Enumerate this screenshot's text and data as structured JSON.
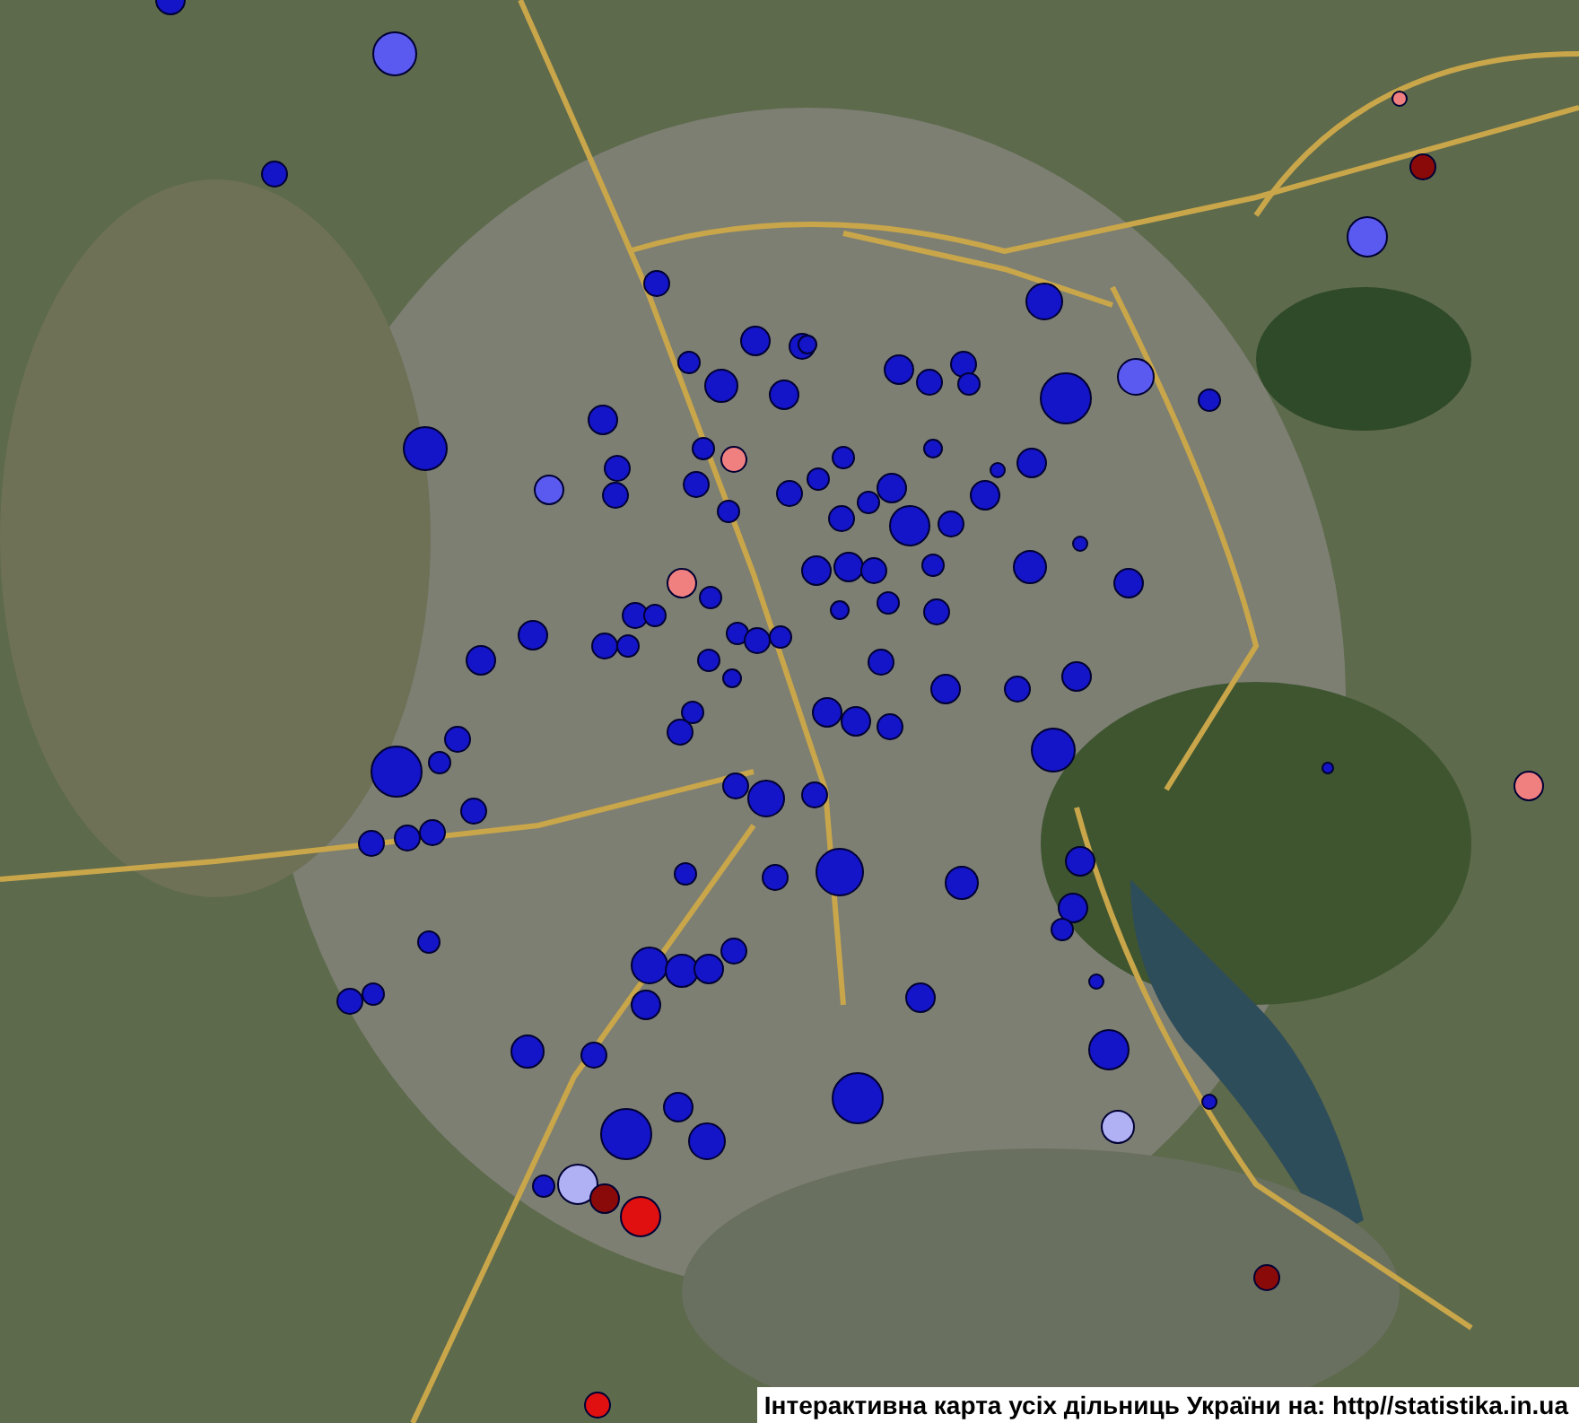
{
  "map": {
    "caption": "Інтерактивна карта усіх дільниць України на: http//statistika.in.ua"
  }
}
